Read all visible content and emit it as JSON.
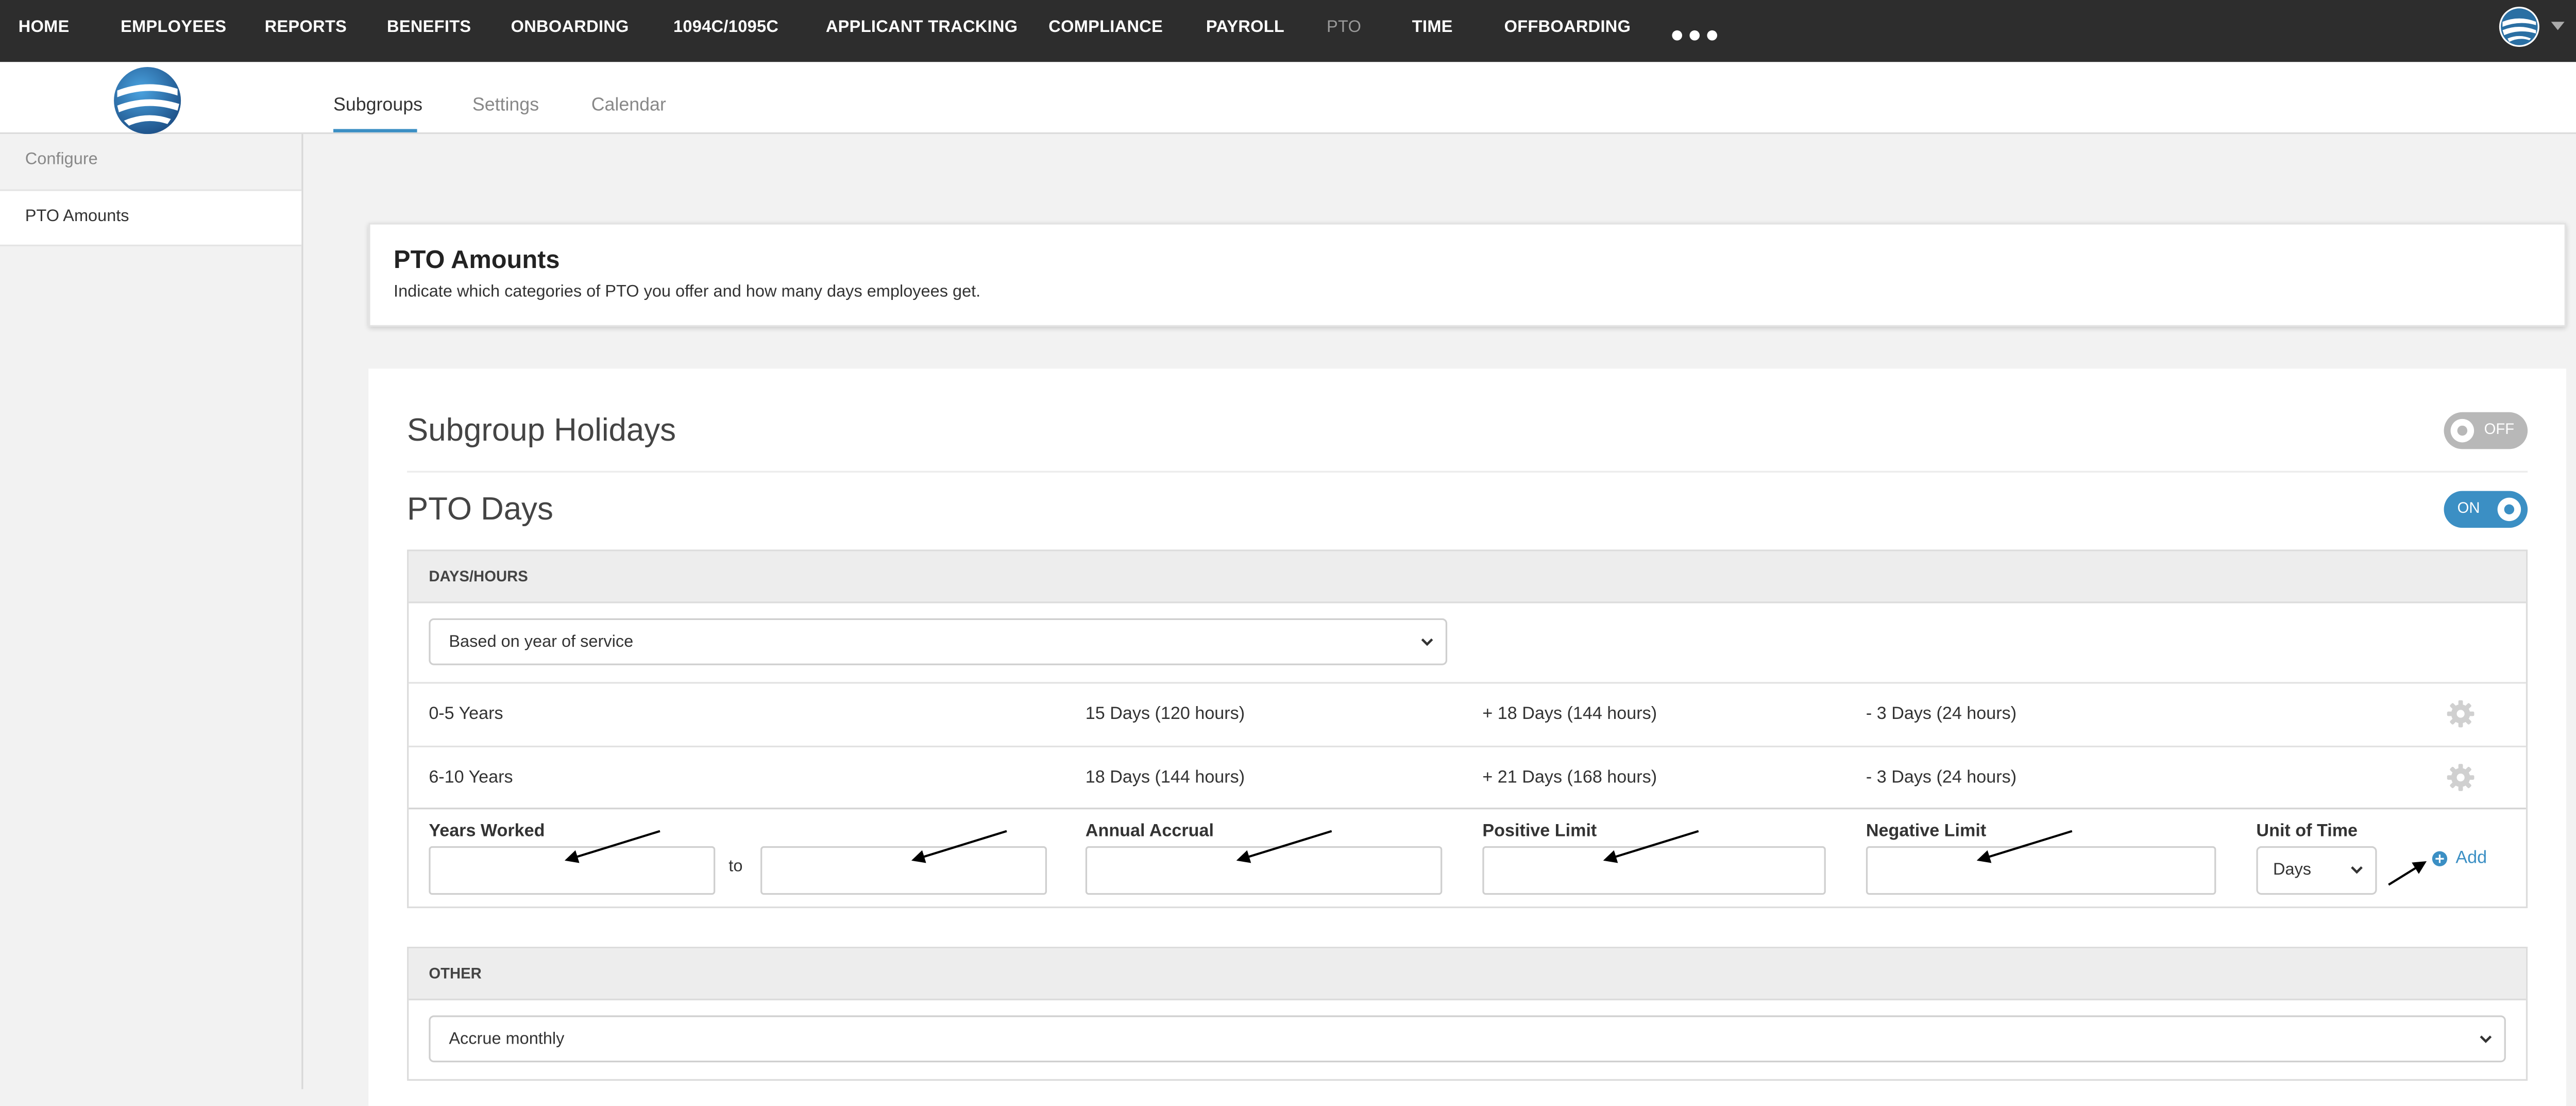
{
  "topnav": {
    "items": [
      "HOME",
      "EMPLOYEES",
      "REPORTS",
      "BENEFITS",
      "ONBOARDING",
      "1094C/1095C",
      "APPLICANT TRACKING",
      "COMPLIANCE",
      "PAYROLL",
      "PTO",
      "TIME",
      "OFFBOARDING"
    ],
    "active": "PTO",
    "more_icon": "more-dots-icon",
    "profile_icon": "globe-avatar-icon",
    "trash_icon": "trash-icon"
  },
  "subheader": {
    "logo_icon": "globe-logo-icon",
    "tabs": [
      "Subgroups",
      "Settings",
      "Calendar"
    ],
    "active_tab": "Subgroups"
  },
  "sidebar": {
    "section": "Configure",
    "items": [
      "PTO Amounts"
    ]
  },
  "page": {
    "title": "PTO Amounts",
    "subtitle": "Indicate which categories of PTO you offer and how many days employees get."
  },
  "subgroup_holidays": {
    "title": "Subgroup Holidays",
    "toggle": "OFF"
  },
  "pto_days": {
    "title": "PTO Days",
    "toggle": "ON",
    "days_hours": {
      "header": "DAYS/HOURS",
      "mode": "Based on year of service",
      "rows": [
        {
          "years": "0-5 Years",
          "annual": "15 Days (120 hours)",
          "positive": "+ 18 Days (144 hours)",
          "negative": "- 3 Days (24 hours)"
        },
        {
          "years": "6-10 Years",
          "annual": "18 Days (144 hours)",
          "positive": "+ 21 Days (168 hours)",
          "negative": "- 3 Days (24 hours)"
        }
      ],
      "form": {
        "years_worked": "Years Worked",
        "to": "to",
        "annual_accrual": "Annual Accrual",
        "positive_limit": "Positive Limit",
        "negative_limit": "Negative Limit",
        "unit_of_time": "Unit of Time",
        "unit_value": "Days",
        "add": "Add"
      }
    },
    "other": {
      "header": "OTHER",
      "accrual": "Accrue monthly"
    }
  },
  "colors": {
    "accent": "#3b8fc4",
    "nav_bg": "#2d2d2d",
    "toggle_off": "#b8b8b8"
  }
}
